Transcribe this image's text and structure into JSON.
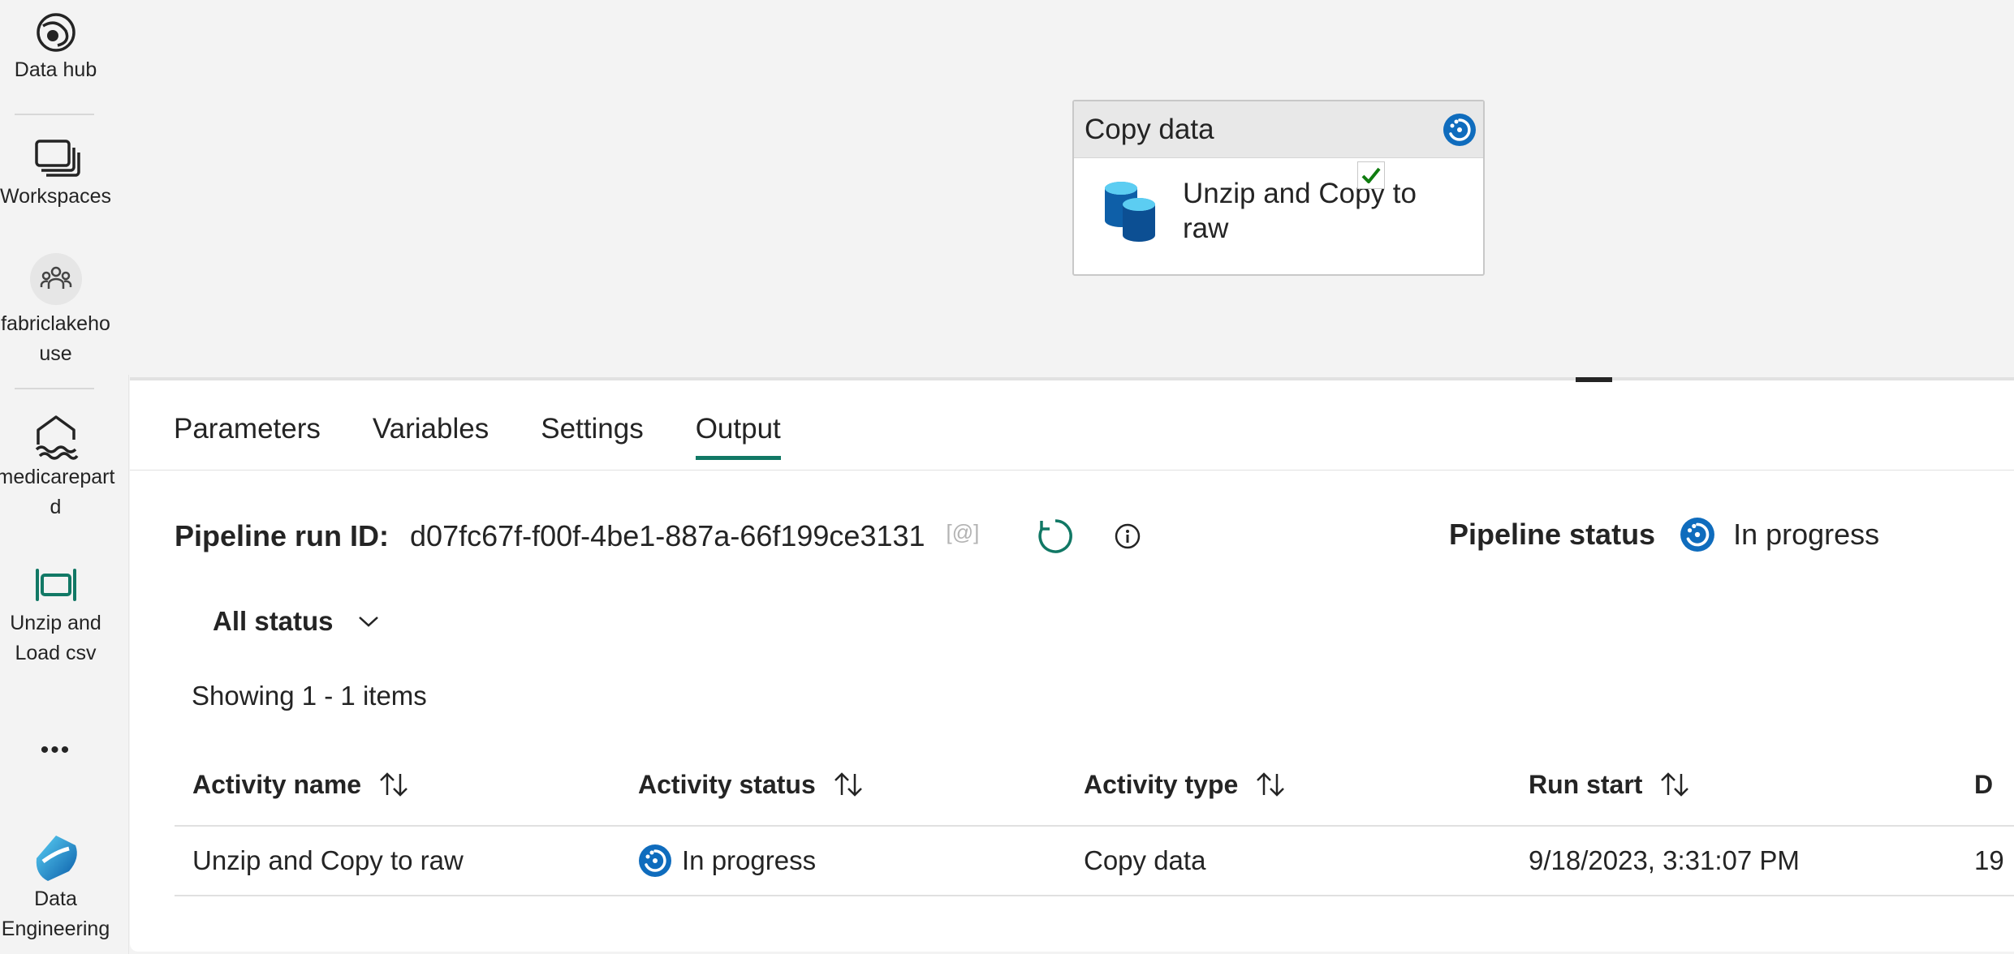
{
  "rail": {
    "items": [
      {
        "label": "Data hub",
        "icon": "data-hub-icon"
      },
      {
        "label": "Workspaces",
        "icon": "workspaces-icon"
      },
      {
        "label": "fabriclakehouse",
        "icon": "people-icon"
      },
      {
        "label": "medicarepartd",
        "icon": "lakehouse-icon"
      },
      {
        "label": "Unzip and Load csv",
        "icon": "pipeline-icon"
      },
      {
        "label": "Data Engineering",
        "icon": "data-engineering-icon"
      }
    ],
    "more_label": "•••"
  },
  "canvas": {
    "node": {
      "type_label": "Copy data",
      "name": "Unzip and Copy to raw",
      "status_icon": "in-progress-icon",
      "activity_icon": "database-icon"
    }
  },
  "panel": {
    "tabs": [
      {
        "label": "Parameters",
        "active": false
      },
      {
        "label": "Variables",
        "active": false
      },
      {
        "label": "Settings",
        "active": false
      },
      {
        "label": "Output",
        "active": true
      }
    ],
    "run": {
      "label": "Pipeline run ID:",
      "id": "d07fc67f-f00f-4be1-887a-66f199ce3131",
      "copy_glyph": "[@]"
    },
    "pipeline_status": {
      "label": "Pipeline status",
      "value": "In progress"
    },
    "filter": {
      "label": "All status"
    },
    "showing": "Showing 1 - 1 items",
    "table": {
      "columns": [
        "Activity name",
        "Activity status",
        "Activity type",
        "Run start",
        "D"
      ],
      "rows": [
        {
          "name": "Unzip and Copy to raw",
          "status": "In progress",
          "type": "Copy data",
          "run_start": "9/18/2023, 3:31:07 PM",
          "duration": "19"
        }
      ]
    }
  },
  "colors": {
    "accent": "#117865",
    "progress_blue": "#0f6cbd",
    "check_green": "#107c10"
  }
}
